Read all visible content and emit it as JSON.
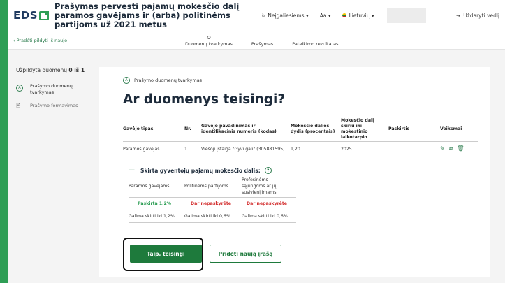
{
  "header": {
    "logo_text": "EDS",
    "title": "Prašymas pervesti pajamų mokesčio dalį paramos gavėjams ir (arba) politinėms partijoms už 2021 metus",
    "accessibility_label": "Neįgaliesiems",
    "font_size_label": "Aa",
    "language_label": "Lietuvių",
    "close_label": "Uždaryti vedlį"
  },
  "subbar": {
    "back_link": "Pradėti pildyti iš naujo",
    "steps": [
      "Duomenų tvarkymas",
      "Prašymas",
      "Pateikimo rezultatas"
    ]
  },
  "sidebar": {
    "progress_prefix": "Užpildyta duomenų",
    "progress_value": "0 iš 1",
    "items": [
      {
        "badge": "A",
        "label": "Prašymo duomenų tvarkymas"
      },
      {
        "label": "Prašymo formavimas"
      }
    ]
  },
  "card": {
    "subtitle_badge": "A",
    "subtitle": "Prašymo duomenų tvarkymas",
    "title": "Ar duomenys teisingi?",
    "table": {
      "headers": [
        "Gavėjo tipas",
        "Nr.",
        "Gavėjo pavadinimas ir identifikacinis numeris (kodas)",
        "Mokesčio dalies dydis (procentais)",
        "Mokesčio dalį skiriu iki mokestinio laikotarpio",
        "Paskirtis",
        "Veiksmai"
      ],
      "rows": [
        {
          "type": "Paramos gavėjas",
          "nr": "1",
          "name": "Viešoji įstaiga \"Gyvi gali\" (305881595)",
          "percent": "1,20",
          "period": "2025",
          "purpose": ""
        }
      ]
    },
    "allocation": {
      "title": "Skirta gyventojų pajamų mokesčio dalis:",
      "headers": [
        "Paramos gavėjams",
        "Politinėms partijoms",
        "Profesinėms sąjungoms ar jų susivienijimams"
      ],
      "status": [
        "Paskirta 1,2%",
        "Dar nepaskyrėte",
        "Dar nepaskyrėte"
      ],
      "limits": [
        "Galima skirti iki 1,2%",
        "Galima skirti iki 0,6%",
        "Galima skirti iki 0,6%"
      ]
    },
    "buttons": {
      "confirm": "Taip, teisingi",
      "add": "Pridėti naują įrašą"
    }
  },
  "colors": {
    "brand_green": "#2e9e55",
    "primary_button": "#1e7a3c",
    "error_red": "#d32f2f"
  }
}
